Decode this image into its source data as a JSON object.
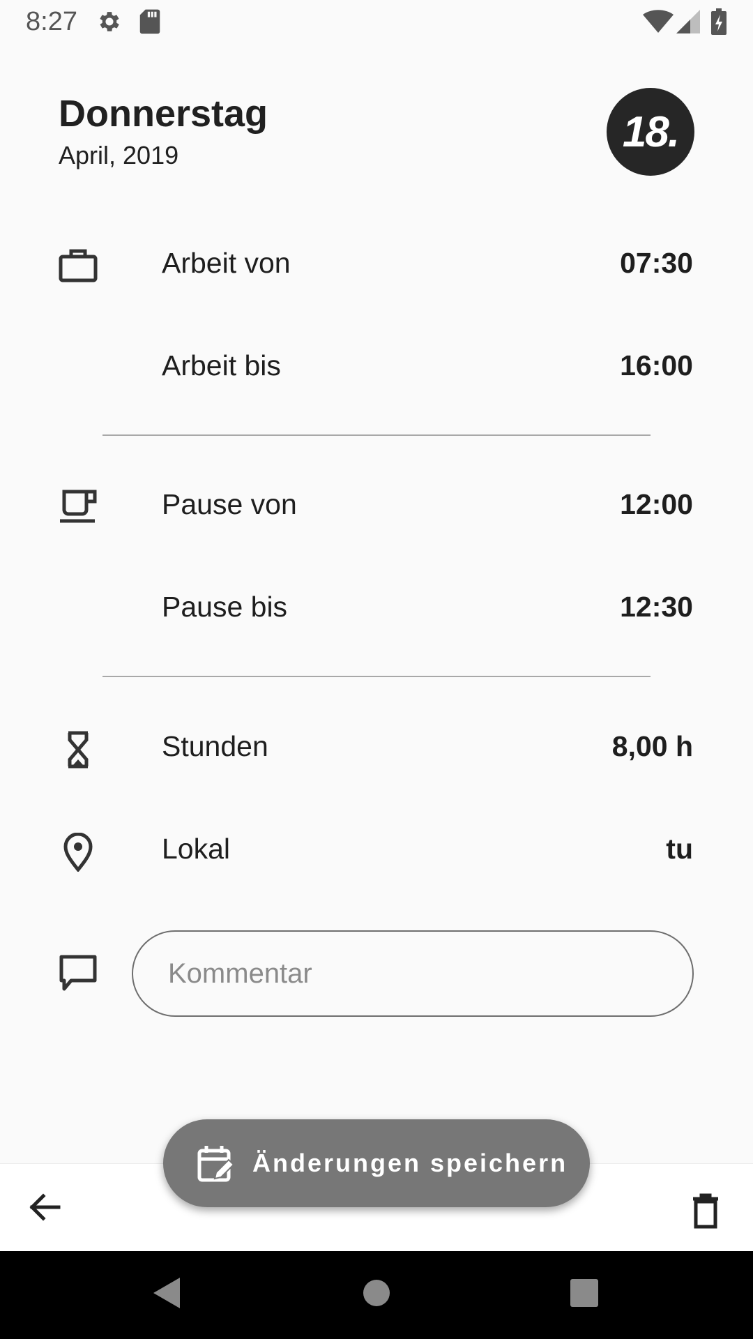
{
  "status_bar": {
    "time": "8:27",
    "icons": [
      "gear-icon",
      "sd-card-icon",
      "wifi-icon",
      "cell-signal-icon",
      "battery-charging-icon"
    ]
  },
  "header": {
    "weekday": "Donnerstag",
    "month_year": "April, 2019",
    "day_badge": "18."
  },
  "rows": {
    "work_from": {
      "icon": "briefcase-icon",
      "label": "Arbeit von",
      "value": "07:30"
    },
    "work_to": {
      "label": "Arbeit bis",
      "value": "16:00"
    },
    "break_from": {
      "icon": "coffee-cup-icon",
      "label": "Pause von",
      "value": "12:00"
    },
    "break_to": {
      "label": "Pause bis",
      "value": "12:30"
    },
    "hours": {
      "icon": "hourglass-icon",
      "label": "Stunden",
      "value": "8,00 h"
    },
    "location": {
      "icon": "location-pin-icon",
      "label": "Lokal",
      "value": "tu"
    }
  },
  "comment": {
    "icon": "comment-icon",
    "placeholder": "Kommentar",
    "value": ""
  },
  "save_button": {
    "icon": "calendar-edit-icon",
    "label": "Änderungen speichern"
  },
  "bottom_bar": {
    "back_icon": "arrow-back-icon",
    "delete_icon": "trash-icon"
  },
  "nav_bar": {
    "icons": [
      "nav-back-icon",
      "nav-home-icon",
      "nav-recents-icon"
    ]
  },
  "colors": {
    "background": "#fafafa",
    "text": "#1e1e1e",
    "badge": "#262626",
    "fab": "#777777",
    "divider": "#a8a8a8"
  }
}
